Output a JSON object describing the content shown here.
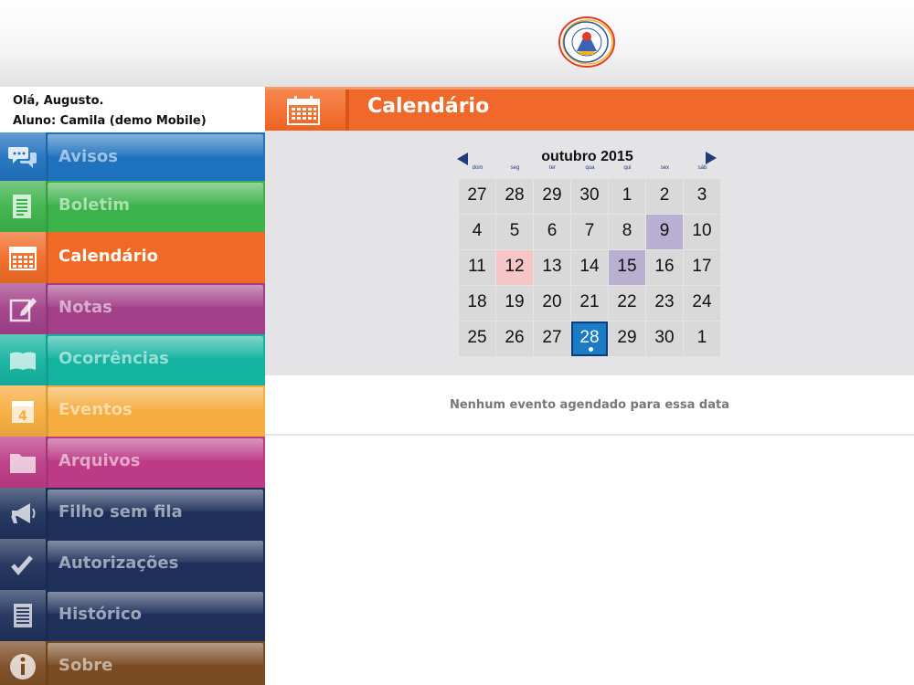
{
  "header": {
    "logo_icon": "school-seal-logo"
  },
  "sidebar": {
    "greeting": "Olá, Augusto.",
    "student": "Aluno: Camila (demo Mobile)",
    "items": [
      {
        "label": "Avisos",
        "icon": "speech-bubbles-icon",
        "color": "#1f72be"
      },
      {
        "label": "Boletim",
        "icon": "document-icon",
        "color": "#3cb24a"
      },
      {
        "label": "Calendário",
        "icon": "calendar-icon",
        "color": "#f06a25",
        "active": true
      },
      {
        "label": "Notas",
        "icon": "pencil-note-icon",
        "color": "#a23f88"
      },
      {
        "label": "Ocorrências",
        "icon": "open-book-icon",
        "color": "#14b3a0"
      },
      {
        "label": "Eventos",
        "icon": "calendar-day-icon",
        "color": "#f6ad3f"
      },
      {
        "label": "Arquivos",
        "icon": "folder-icon",
        "color": "#bc3a86"
      },
      {
        "label": "Filho sem fila",
        "icon": "megaphone-icon",
        "color": "#1e305a"
      },
      {
        "label": "Autorizações",
        "icon": "checkmark-icon",
        "color": "#1e305a"
      },
      {
        "label": "Histórico",
        "icon": "list-document-icon",
        "color": "#1e305a"
      },
      {
        "label": "Sobre",
        "icon": "info-icon",
        "color": "#7a4a22"
      }
    ]
  },
  "main": {
    "title": "Calendário",
    "calendar": {
      "month_label": "outubro 2015",
      "weekdays": [
        "dom",
        "seg",
        "ter",
        "qua",
        "qui",
        "sex",
        "sáb"
      ],
      "weeks": [
        [
          "27",
          "28",
          "29",
          "30",
          "1",
          "2",
          "3"
        ],
        [
          "4",
          "5",
          "6",
          "7",
          "8",
          "9",
          "10"
        ],
        [
          "11",
          "12",
          "13",
          "14",
          "15",
          "16",
          "17"
        ],
        [
          "18",
          "19",
          "20",
          "21",
          "22",
          "23",
          "24"
        ],
        [
          "25",
          "26",
          "27",
          "28",
          "29",
          "30",
          "1"
        ]
      ],
      "marked_purple": [
        "1-5",
        "2-4"
      ],
      "marked_pink": [
        "2-1"
      ],
      "selected": "4-3",
      "colors": {
        "purple": "#b8afd1",
        "pink": "#f6c5c5",
        "selected": "#1c7bc5"
      }
    },
    "no_events_text": "Nenhum evento agendado para essa data"
  }
}
